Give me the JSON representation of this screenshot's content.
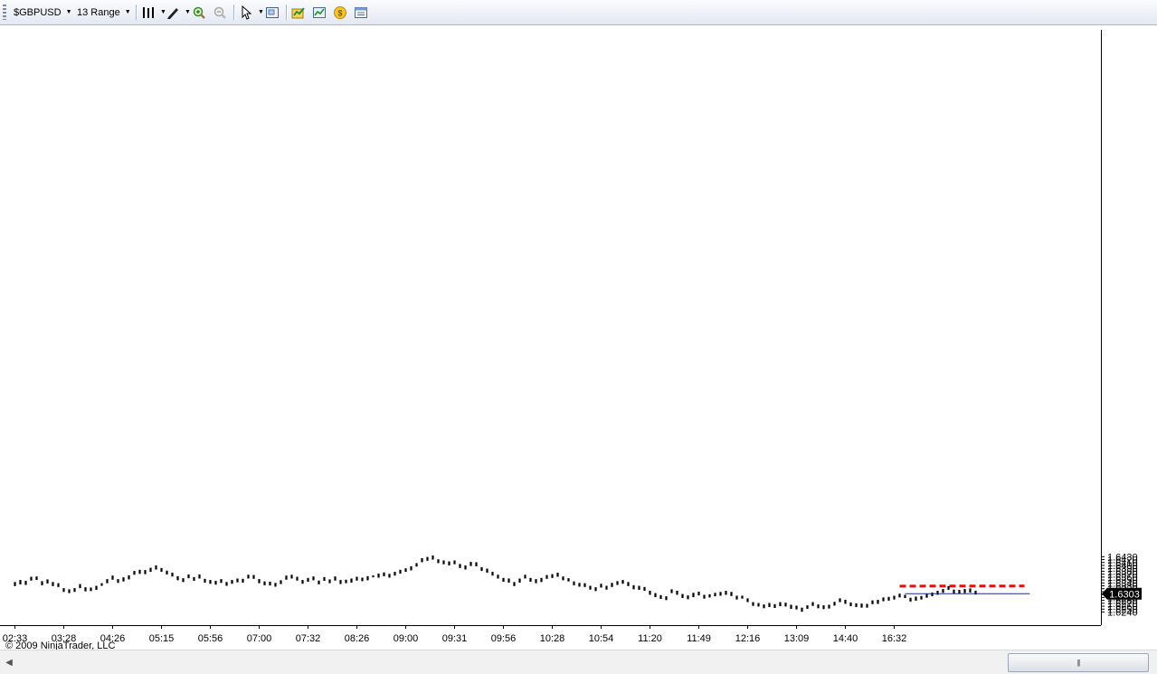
{
  "toolbar": {
    "instrument": "$GBPUSD",
    "bar_type": "13 Range",
    "icons": [
      "bar-style-icon",
      "drawing-tool-icon",
      "zoom-in-icon",
      "zoom-out-icon",
      "pointer-icon",
      "data-box-icon",
      "indicators-icon",
      "strategies-icon",
      "currency-icon",
      "properties-icon"
    ]
  },
  "copyright": "© 2009 NinjaTrader, LLC",
  "colors": {
    "bars": "#000000",
    "red_line": "#dd1111",
    "blue_line": "#1a2a88",
    "label_bg": "#000000"
  },
  "chart_data": {
    "type": "ohlc-bar",
    "symbol": "$GBPUSD",
    "ylim": [
      1.6235,
      1.644
    ],
    "y_ticks": [
      "1.6240",
      "1.6250",
      "1.6260",
      "1.6270",
      "1.6280",
      "1.6290",
      "1.6300",
      "1.6310",
      "1.6320",
      "1.6330",
      "1.6340",
      "1.6350",
      "1.6360",
      "1.6370",
      "1.6380",
      "1.6390",
      "1.6400",
      "1.6410",
      "1.6420",
      "1.6430"
    ],
    "x_ticks": [
      {
        "label": "02:33",
        "bar": 0
      },
      {
        "label": "03:28",
        "bar": 9
      },
      {
        "label": "04:26",
        "bar": 18
      },
      {
        "label": "05:15",
        "bar": 27
      },
      {
        "label": "05:56",
        "bar": 36
      },
      {
        "label": "07:00",
        "bar": 45
      },
      {
        "label": "07:32",
        "bar": 54
      },
      {
        "label": "08:26",
        "bar": 63
      },
      {
        "label": "09:00",
        "bar": 72
      },
      {
        "label": "09:31",
        "bar": 81
      },
      {
        "label": "09:56",
        "bar": 90
      },
      {
        "label": "10:28",
        "bar": 99
      },
      {
        "label": "10:54",
        "bar": 108
      },
      {
        "label": "11:20",
        "bar": 117
      },
      {
        "label": "11:49",
        "bar": 126
      },
      {
        "label": "12:16",
        "bar": 135
      },
      {
        "label": "13:09",
        "bar": 144
      },
      {
        "label": "14:40",
        "bar": 153
      },
      {
        "label": "16:32",
        "bar": 162
      }
    ],
    "bars": [
      [
        1.6343,
        1.6329
      ],
      [
        1.635,
        1.6335
      ],
      [
        1.6347,
        1.6333
      ],
      [
        1.6361,
        1.6348
      ],
      [
        1.6362,
        1.635
      ],
      [
        1.6346,
        1.6332
      ],
      [
        1.6352,
        1.6338
      ],
      [
        1.6343,
        1.6329
      ],
      [
        1.6339,
        1.6326
      ],
      [
        1.6322,
        1.6309
      ],
      [
        1.6318,
        1.6305
      ],
      [
        1.6322,
        1.6309
      ],
      [
        1.6336,
        1.6322
      ],
      [
        1.6325,
        1.6311
      ],
      [
        1.6324,
        1.6312
      ],
      [
        1.633,
        1.6316
      ],
      [
        1.6339,
        1.633
      ],
      [
        1.6353,
        1.6339
      ],
      [
        1.6365,
        1.6351
      ],
      [
        1.6353,
        1.634
      ],
      [
        1.6359,
        1.6345
      ],
      [
        1.6366,
        1.6352
      ],
      [
        1.6381,
        1.6368
      ],
      [
        1.6385,
        1.6371
      ],
      [
        1.6384,
        1.637
      ],
      [
        1.6392,
        1.6378
      ],
      [
        1.64,
        1.6386
      ],
      [
        1.6391,
        1.6378
      ],
      [
        1.6382,
        1.6369
      ],
      [
        1.6375,
        1.6362
      ],
      [
        1.6363,
        1.6349
      ],
      [
        1.6356,
        1.6343
      ],
      [
        1.6369,
        1.6356
      ],
      [
        1.636,
        1.6347
      ],
      [
        1.6369,
        1.6355
      ],
      [
        1.6354,
        1.6341
      ],
      [
        1.635,
        1.6337
      ],
      [
        1.6347,
        1.6334
      ],
      [
        1.6353,
        1.634
      ],
      [
        1.6343,
        1.633
      ],
      [
        1.635,
        1.6337
      ],
      [
        1.6355,
        1.6342
      ],
      [
        1.6354,
        1.6341
      ],
      [
        1.6368,
        1.6355
      ],
      [
        1.6367,
        1.6354
      ],
      [
        1.6353,
        1.6339
      ],
      [
        1.6345,
        1.6332
      ],
      [
        1.6344,
        1.6331
      ],
      [
        1.634,
        1.6327
      ],
      [
        1.6349,
        1.6336
      ],
      [
        1.6365,
        1.6351
      ],
      [
        1.6368,
        1.6355
      ],
      [
        1.6361,
        1.6348
      ],
      [
        1.635,
        1.6337
      ],
      [
        1.6357,
        1.6344
      ],
      [
        1.6362,
        1.6349
      ],
      [
        1.6348,
        1.6335
      ],
      [
        1.636,
        1.6347
      ],
      [
        1.6352,
        1.6339
      ],
      [
        1.6362,
        1.6348
      ],
      [
        1.635,
        1.6336
      ],
      [
        1.6351,
        1.6339
      ],
      [
        1.6355,
        1.6341
      ],
      [
        1.6361,
        1.6348
      ],
      [
        1.6358,
        1.6346
      ],
      [
        1.6363,
        1.6349
      ],
      [
        1.6366,
        1.6359
      ],
      [
        1.6372,
        1.6358
      ],
      [
        1.6376,
        1.6363
      ],
      [
        1.6371,
        1.6358
      ],
      [
        1.6378,
        1.6365
      ],
      [
        1.6385,
        1.6372
      ],
      [
        1.639,
        1.6378
      ],
      [
        1.6397,
        1.6383
      ],
      [
        1.6408,
        1.6396
      ],
      [
        1.6425,
        1.6411
      ],
      [
        1.6429,
        1.6416
      ],
      [
        1.6434,
        1.642
      ],
      [
        1.6421,
        1.6408
      ],
      [
        1.6417,
        1.6404
      ],
      [
        1.6414,
        1.64
      ],
      [
        1.6417,
        1.6404
      ],
      [
        1.6405,
        1.6391
      ],
      [
        1.64,
        1.6386
      ],
      [
        1.6412,
        1.6398
      ],
      [
        1.6411,
        1.6397
      ],
      [
        1.6394,
        1.6381
      ],
      [
        1.6389,
        1.6375
      ],
      [
        1.6378,
        1.6365
      ],
      [
        1.6368,
        1.6355
      ],
      [
        1.6357,
        1.6344
      ],
      [
        1.6355,
        1.6341
      ],
      [
        1.6343,
        1.6329
      ],
      [
        1.6355,
        1.6341
      ],
      [
        1.6368,
        1.6355
      ],
      [
        1.6357,
        1.6344
      ],
      [
        1.6353,
        1.6339
      ],
      [
        1.6357,
        1.6343
      ],
      [
        1.6367,
        1.6354
      ],
      [
        1.637,
        1.6357
      ],
      [
        1.6375,
        1.6361
      ],
      [
        1.6362,
        1.6349
      ],
      [
        1.6356,
        1.6345
      ],
      [
        1.6345,
        1.6332
      ],
      [
        1.634,
        1.6327
      ],
      [
        1.6339,
        1.6326
      ],
      [
        1.633,
        1.6317
      ],
      [
        1.6325,
        1.6312
      ],
      [
        1.6337,
        1.6324
      ],
      [
        1.633,
        1.6317
      ],
      [
        1.634,
        1.6326
      ],
      [
        1.6346,
        1.6333
      ],
      [
        1.635,
        1.6337
      ],
      [
        1.6343,
        1.6329
      ],
      [
        1.6332,
        1.6318
      ],
      [
        1.633,
        1.6316
      ],
      [
        1.6326,
        1.6313
      ],
      [
        1.6313,
        1.6299
      ],
      [
        1.6305,
        1.6291
      ],
      [
        1.6298,
        1.6285
      ],
      [
        1.6294,
        1.6281
      ],
      [
        1.6318,
        1.6305
      ],
      [
        1.6313,
        1.6299
      ],
      [
        1.6302,
        1.6288
      ],
      [
        1.6297,
        1.6284
      ],
      [
        1.6306,
        1.6291
      ],
      [
        1.631,
        1.6297
      ],
      [
        1.6299,
        1.6286
      ],
      [
        1.6301,
        1.629
      ],
      [
        1.6306,
        1.6294
      ],
      [
        1.6309,
        1.6296
      ],
      [
        1.6313,
        1.6299
      ],
      [
        1.6309,
        1.6295
      ],
      [
        1.6296,
        1.6283
      ],
      [
        1.6296,
        1.6286
      ],
      [
        1.6287,
        1.6274
      ],
      [
        1.6274,
        1.6261
      ],
      [
        1.6271,
        1.6259
      ],
      [
        1.6266,
        1.6253
      ],
      [
        1.6271,
        1.6257
      ],
      [
        1.6267,
        1.6254
      ],
      [
        1.6274,
        1.626
      ],
      [
        1.6272,
        1.6259
      ],
      [
        1.6265,
        1.6251
      ],
      [
        1.6262,
        1.6249
      ],
      [
        1.6255,
        1.6241
      ],
      [
        1.6263,
        1.6251
      ],
      [
        1.6274,
        1.6261
      ],
      [
        1.6266,
        1.6253
      ],
      [
        1.6263,
        1.625
      ],
      [
        1.6265,
        1.6252
      ],
      [
        1.6275,
        1.6262
      ],
      [
        1.6287,
        1.6274
      ],
      [
        1.6282,
        1.6268
      ],
      [
        1.6273,
        1.626
      ],
      [
        1.627,
        1.6257
      ],
      [
        1.6269,
        1.6255
      ],
      [
        1.6268,
        1.6255
      ],
      [
        1.628,
        1.6267
      ],
      [
        1.6282,
        1.6268
      ],
      [
        1.629,
        1.6277
      ],
      [
        1.6292,
        1.6279
      ],
      [
        1.6296,
        1.6283
      ],
      [
        1.6303,
        1.629
      ],
      [
        1.6299,
        1.6288
      ],
      [
        1.6289,
        1.6276
      ],
      [
        1.6293,
        1.6279
      ],
      [
        1.6295,
        1.6283
      ],
      [
        1.6302,
        1.6289
      ],
      [
        1.6307,
        1.6294
      ],
      [
        1.6313,
        1.6299
      ],
      [
        1.6319,
        1.6306
      ],
      [
        1.6329,
        1.6316
      ],
      [
        1.6317,
        1.6303
      ],
      [
        1.6316,
        1.6303
      ],
      [
        1.6319,
        1.6305
      ],
      [
        1.6321,
        1.6307
      ],
      [
        1.6313,
        1.63
      ]
    ],
    "red_dashed_line": {
      "from_bar": 163,
      "to_bar": 186,
      "y_start": 1.6329,
      "y_end": 1.63295
    },
    "blue_line": {
      "from_bar": 164,
      "to_bar": 187,
      "y": 1.63028
    },
    "last_price_label": "1.6303"
  }
}
